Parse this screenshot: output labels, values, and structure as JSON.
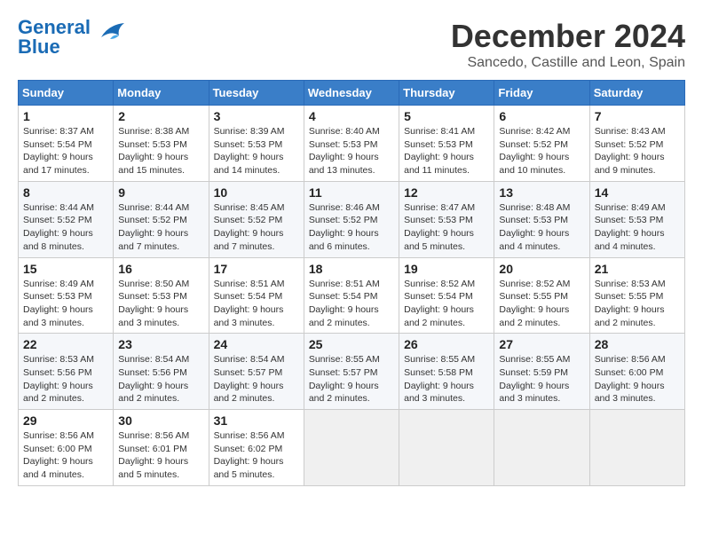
{
  "header": {
    "logo_general": "General",
    "logo_blue": "Blue",
    "month": "December 2024",
    "location": "Sancedo, Castille and Leon, Spain"
  },
  "columns": [
    "Sunday",
    "Monday",
    "Tuesday",
    "Wednesday",
    "Thursday",
    "Friday",
    "Saturday"
  ],
  "weeks": [
    [
      {
        "day": "1",
        "sunrise": "8:37 AM",
        "sunset": "5:54 PM",
        "daylight": "9 hours and 17 minutes."
      },
      {
        "day": "2",
        "sunrise": "8:38 AM",
        "sunset": "5:53 PM",
        "daylight": "9 hours and 15 minutes."
      },
      {
        "day": "3",
        "sunrise": "8:39 AM",
        "sunset": "5:53 PM",
        "daylight": "9 hours and 14 minutes."
      },
      {
        "day": "4",
        "sunrise": "8:40 AM",
        "sunset": "5:53 PM",
        "daylight": "9 hours and 13 minutes."
      },
      {
        "day": "5",
        "sunrise": "8:41 AM",
        "sunset": "5:53 PM",
        "daylight": "9 hours and 11 minutes."
      },
      {
        "day": "6",
        "sunrise": "8:42 AM",
        "sunset": "5:52 PM",
        "daylight": "9 hours and 10 minutes."
      },
      {
        "day": "7",
        "sunrise": "8:43 AM",
        "sunset": "5:52 PM",
        "daylight": "9 hours and 9 minutes."
      }
    ],
    [
      {
        "day": "8",
        "sunrise": "8:44 AM",
        "sunset": "5:52 PM",
        "daylight": "9 hours and 8 minutes."
      },
      {
        "day": "9",
        "sunrise": "8:44 AM",
        "sunset": "5:52 PM",
        "daylight": "9 hours and 7 minutes."
      },
      {
        "day": "10",
        "sunrise": "8:45 AM",
        "sunset": "5:52 PM",
        "daylight": "9 hours and 7 minutes."
      },
      {
        "day": "11",
        "sunrise": "8:46 AM",
        "sunset": "5:52 PM",
        "daylight": "9 hours and 6 minutes."
      },
      {
        "day": "12",
        "sunrise": "8:47 AM",
        "sunset": "5:53 PM",
        "daylight": "9 hours and 5 minutes."
      },
      {
        "day": "13",
        "sunrise": "8:48 AM",
        "sunset": "5:53 PM",
        "daylight": "9 hours and 4 minutes."
      },
      {
        "day": "14",
        "sunrise": "8:49 AM",
        "sunset": "5:53 PM",
        "daylight": "9 hours and 4 minutes."
      }
    ],
    [
      {
        "day": "15",
        "sunrise": "8:49 AM",
        "sunset": "5:53 PM",
        "daylight": "9 hours and 3 minutes."
      },
      {
        "day": "16",
        "sunrise": "8:50 AM",
        "sunset": "5:53 PM",
        "daylight": "9 hours and 3 minutes."
      },
      {
        "day": "17",
        "sunrise": "8:51 AM",
        "sunset": "5:54 PM",
        "daylight": "9 hours and 3 minutes."
      },
      {
        "day": "18",
        "sunrise": "8:51 AM",
        "sunset": "5:54 PM",
        "daylight": "9 hours and 2 minutes."
      },
      {
        "day": "19",
        "sunrise": "8:52 AM",
        "sunset": "5:54 PM",
        "daylight": "9 hours and 2 minutes."
      },
      {
        "day": "20",
        "sunrise": "8:52 AM",
        "sunset": "5:55 PM",
        "daylight": "9 hours and 2 minutes."
      },
      {
        "day": "21",
        "sunrise": "8:53 AM",
        "sunset": "5:55 PM",
        "daylight": "9 hours and 2 minutes."
      }
    ],
    [
      {
        "day": "22",
        "sunrise": "8:53 AM",
        "sunset": "5:56 PM",
        "daylight": "9 hours and 2 minutes."
      },
      {
        "day": "23",
        "sunrise": "8:54 AM",
        "sunset": "5:56 PM",
        "daylight": "9 hours and 2 minutes."
      },
      {
        "day": "24",
        "sunrise": "8:54 AM",
        "sunset": "5:57 PM",
        "daylight": "9 hours and 2 minutes."
      },
      {
        "day": "25",
        "sunrise": "8:55 AM",
        "sunset": "5:57 PM",
        "daylight": "9 hours and 2 minutes."
      },
      {
        "day": "26",
        "sunrise": "8:55 AM",
        "sunset": "5:58 PM",
        "daylight": "9 hours and 3 minutes."
      },
      {
        "day": "27",
        "sunrise": "8:55 AM",
        "sunset": "5:59 PM",
        "daylight": "9 hours and 3 minutes."
      },
      {
        "day": "28",
        "sunrise": "8:56 AM",
        "sunset": "6:00 PM",
        "daylight": "9 hours and 3 minutes."
      }
    ],
    [
      {
        "day": "29",
        "sunrise": "8:56 AM",
        "sunset": "6:00 PM",
        "daylight": "9 hours and 4 minutes."
      },
      {
        "day": "30",
        "sunrise": "8:56 AM",
        "sunset": "6:01 PM",
        "daylight": "9 hours and 5 minutes."
      },
      {
        "day": "31",
        "sunrise": "8:56 AM",
        "sunset": "6:02 PM",
        "daylight": "9 hours and 5 minutes."
      },
      null,
      null,
      null,
      null
    ]
  ]
}
